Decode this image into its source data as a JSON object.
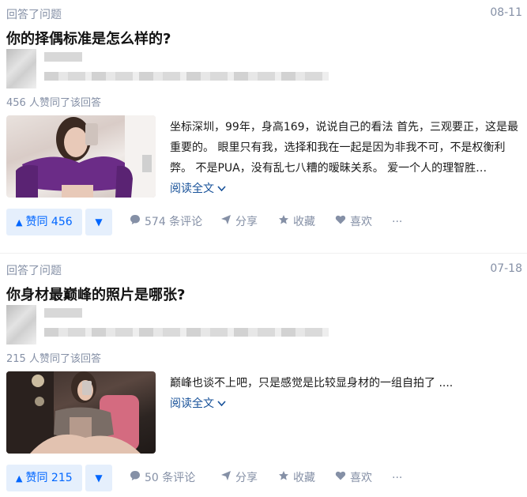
{
  "answers": [
    {
      "meta": "回答了问题",
      "date": "08-11",
      "question": "你的择偶标准是怎么样的?",
      "votes_text": "456 人赞同了该回答",
      "excerpt": "坐标深圳，99年，身高169，说说自己的看法 首先，三观要正，这是最重要的。 眼里只有我，选择和我在一起是因为非我不可，不是权衡利弊。 不是PUA，没有乱七八糟的暧昧关系。 爱一个人的理智胜…",
      "read_more": "阅读全文",
      "vote_label": "赞同 456",
      "comments": "574 条评论",
      "share": "分享",
      "favorite": "收藏",
      "like": "喜欢",
      "more": "···"
    },
    {
      "meta": "回答了问题",
      "date": "07-18",
      "question": "你身材最巅峰的照片是哪张?",
      "votes_text": "215 人赞同了该回答",
      "excerpt": "巅峰也谈不上吧，只是感觉是比较显身材的一组自拍了 ....",
      "read_more": "阅读全文",
      "vote_label": "赞同 215",
      "comments": "50 条评论",
      "share": "分享",
      "favorite": "收藏",
      "like": "喜欢",
      "more": "···"
    }
  ],
  "icons": {
    "vote_up": "▲",
    "vote_down": "▼",
    "comment": "comment-icon",
    "share": "share-icon",
    "favorite": "star-icon",
    "like": "heart-icon",
    "read_more_chevron": "chevron-down-icon"
  },
  "colors": {
    "accent": "#0066ff",
    "link": "#175199",
    "muted": "#8590a6",
    "vote_bg": "#e5effc"
  }
}
